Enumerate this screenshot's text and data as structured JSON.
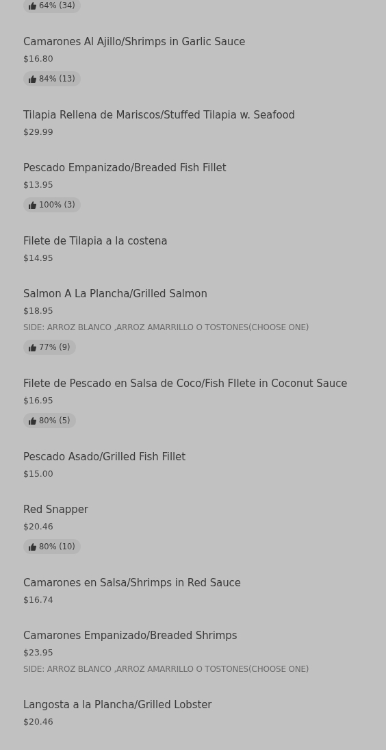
{
  "previous_item_rating": {
    "text": "64% (34)"
  },
  "items": [
    {
      "name": "Camarones Al Ajillo/Shrimps in Garlic Sauce",
      "price": "$16.80",
      "rating": "84% (13)"
    },
    {
      "name": "Tilapia Rellena de Mariscos/Stuffed Tilapia w. Seafood",
      "price": "$29.99"
    },
    {
      "name": "Pescado Empanizado/Breaded Fish Fillet",
      "price": "$13.95",
      "rating": "100% (3)"
    },
    {
      "name": "Filete de Tilapia a la costena",
      "price": "$14.95"
    },
    {
      "name": "Salmon A La Plancha/Grilled Salmon",
      "price": "$18.95",
      "description": "SIDE: ARROZ BLANCO ,ARROZ AMARRILLO O TOSTONES(CHOOSE ONE)",
      "rating": "77% (9)"
    },
    {
      "name": "Filete de Pescado en Salsa de Coco/Fish FIlete in Coconut Sauce",
      "price": "$16.95",
      "rating": "80% (5)"
    },
    {
      "name": "Pescado Asado/Grilled Fish Fillet",
      "price": "$15.00"
    },
    {
      "name": "Red Snapper",
      "price": "$20.46",
      "rating": "80% (10)"
    },
    {
      "name": "Camarones en Salsa/Shrimps in Red Sauce",
      "price": "$16.74"
    },
    {
      "name": "Camarones Empanizado/Breaded Shrimps",
      "price": "$23.95",
      "description": "SIDE: ARROZ BLANCO ,ARROZ AMARRILLO O TOSTONES(CHOOSE ONE)"
    },
    {
      "name": "Langosta a la Plancha/Grilled Lobster",
      "price": "$20.46"
    }
  ]
}
